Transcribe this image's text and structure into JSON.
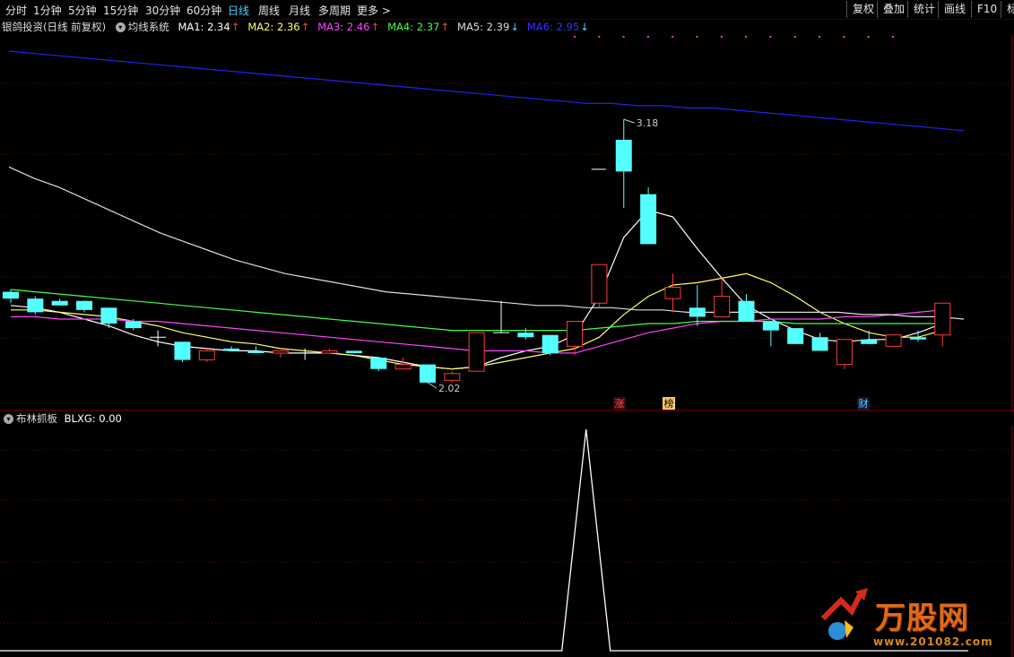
{
  "toolbar": {
    "periods": [
      "分时",
      "1分钟",
      "5分钟",
      "15分钟",
      "30分钟",
      "60分钟",
      "日线",
      "周线",
      "月线",
      "多周期",
      "更多 >"
    ],
    "active_period": "日线",
    "right_buttons": [
      "复权",
      "叠加",
      "统计",
      "画线",
      "F10",
      "标"
    ]
  },
  "info": {
    "stock": "银鸽投资(日线 前复权)",
    "indicator": "均线系统",
    "ma": [
      {
        "label": "MA1: 2.34",
        "arrow": "↑",
        "color": "#ffffff",
        "arrow_color": "#ff4444"
      },
      {
        "label": "MA2: 2.36",
        "arrow": "↑",
        "color": "#ffff66",
        "arrow_color": "#ff4444"
      },
      {
        "label": "MA3: 2.46",
        "arrow": "↑",
        "color": "#ff44ff",
        "arrow_color": "#ff4444"
      },
      {
        "label": "MA4: 2.37",
        "arrow": "↑",
        "color": "#44ff44",
        "arrow_color": "#ff4444"
      },
      {
        "label": "MA5: 2.39",
        "arrow": "↓",
        "color": "#dddddd",
        "arrow_color": "#44ddff"
      },
      {
        "label": "MA6: 2.95",
        "arrow": "↓",
        "color": "#3333ff",
        "arrow_color": "#44ddff"
      }
    ]
  },
  "price_chart": {
    "high_label": "3.18",
    "low_label": "2.02",
    "markers": [
      {
        "text": "涨",
        "color": "#ff5555",
        "bg": "#3a0a0a"
      },
      {
        "text": "榜",
        "color": "#000000",
        "bg": "#ffcc66"
      },
      {
        "text": "财",
        "color": "#66ccff",
        "bg": "#0a1a3a"
      }
    ],
    "candles": [
      {
        "o": 2.42,
        "c": 2.39,
        "h": 2.43,
        "l": 2.37
      },
      {
        "o": 2.39,
        "c": 2.33,
        "h": 2.4,
        "l": 2.32
      },
      {
        "o": 2.38,
        "c": 2.36,
        "h": 2.39,
        "l": 2.36
      },
      {
        "o": 2.38,
        "c": 2.34,
        "h": 2.38,
        "l": 2.33
      },
      {
        "o": 2.35,
        "c": 2.28,
        "h": 2.35,
        "l": 2.26
      },
      {
        "o": 2.29,
        "c": 2.26,
        "h": 2.3,
        "l": 2.25
      },
      {
        "o": 2.22,
        "c": 2.22,
        "h": 2.25,
        "l": 2.18
      },
      {
        "o": 2.2,
        "c": 2.12,
        "h": 2.2,
        "l": 2.11
      },
      {
        "o": 2.12,
        "c": 2.16,
        "h": 2.17,
        "l": 2.11
      },
      {
        "o": 2.17,
        "c": 2.16,
        "h": 2.18,
        "l": 2.16
      },
      {
        "o": 2.16,
        "c": 2.15,
        "h": 2.18,
        "l": 2.15
      },
      {
        "o": 2.15,
        "c": 2.16,
        "h": 2.16,
        "l": 2.13
      },
      {
        "o": 2.15,
        "c": 2.15,
        "h": 2.17,
        "l": 2.12
      },
      {
        "o": 2.15,
        "c": 2.16,
        "h": 2.17,
        "l": 2.15
      },
      {
        "o": 2.16,
        "c": 2.15,
        "h": 2.16,
        "l": 2.15
      },
      {
        "o": 2.13,
        "c": 2.08,
        "h": 2.13,
        "l": 2.07
      },
      {
        "o": 2.08,
        "c": 2.1,
        "h": 2.13,
        "l": 2.08
      },
      {
        "o": 2.1,
        "c": 2.02,
        "h": 2.1,
        "l": 2.02
      },
      {
        "o": 2.03,
        "c": 2.06,
        "h": 2.07,
        "l": 2.02
      },
      {
        "o": 2.07,
        "c": 2.24,
        "h": 2.24,
        "l": 2.07
      },
      {
        "o": 2.24,
        "c": 2.24,
        "h": 2.38,
        "l": 2.24
      },
      {
        "o": 2.24,
        "c": 2.22,
        "h": 2.26,
        "l": 2.21
      },
      {
        "o": 2.23,
        "c": 2.15,
        "h": 2.23,
        "l": 2.14
      },
      {
        "o": 2.18,
        "c": 2.29,
        "h": 2.29,
        "l": 2.14
      },
      {
        "o": 2.37,
        "c": 2.54,
        "h": 2.54,
        "l": 2.35
      },
      {
        "o": 3.09,
        "c": 2.95,
        "h": 3.18,
        "l": 2.79
      },
      {
        "o": 2.85,
        "c": 2.63,
        "h": 2.88,
        "l": 2.63
      },
      {
        "o": 2.39,
        "c": 2.44,
        "h": 2.5,
        "l": 2.33
      },
      {
        "o": 2.35,
        "c": 2.31,
        "h": 2.45,
        "l": 2.27
      },
      {
        "o": 2.31,
        "c": 2.4,
        "h": 2.48,
        "l": 2.31
      },
      {
        "o": 2.38,
        "c": 2.29,
        "h": 2.41,
        "l": 2.29
      },
      {
        "o": 2.29,
        "c": 2.25,
        "h": 2.29,
        "l": 2.18
      },
      {
        "o": 2.26,
        "c": 2.19,
        "h": 2.26,
        "l": 2.19
      },
      {
        "o": 2.22,
        "c": 2.16,
        "h": 2.24,
        "l": 2.16
      },
      {
        "o": 2.1,
        "c": 2.21,
        "h": 2.21,
        "l": 2.08
      },
      {
        "o": 2.21,
        "c": 2.19,
        "h": 2.25,
        "l": 2.19
      },
      {
        "o": 2.18,
        "c": 2.23,
        "h": 2.23,
        "l": 2.18
      },
      {
        "o": 2.22,
        "c": 2.21,
        "h": 2.25,
        "l": 2.2
      },
      {
        "o": 2.23,
        "c": 2.37,
        "h": 2.37,
        "l": 2.18
      }
    ],
    "ma_lines": [
      {
        "name": "MA1",
        "color": "#ffffff",
        "values": [
          2.36,
          2.35,
          2.33,
          2.3,
          2.27,
          2.23,
          2.2,
          2.18,
          2.17,
          2.16,
          2.16,
          2.15,
          2.15,
          2.15,
          2.14,
          2.13,
          2.11,
          2.09,
          2.08,
          2.09,
          2.13,
          2.16,
          2.18,
          2.23,
          2.4,
          2.66,
          2.78,
          2.75,
          2.61,
          2.48,
          2.36,
          2.3,
          2.25,
          2.21,
          2.2,
          2.21,
          2.21,
          2.24,
          2.28
        ]
      },
      {
        "name": "MA2",
        "color": "#ffff66",
        "values": [
          2.34,
          2.34,
          2.33,
          2.32,
          2.31,
          2.29,
          2.27,
          2.24,
          2.22,
          2.2,
          2.19,
          2.17,
          2.16,
          2.15,
          2.14,
          2.12,
          2.1,
          2.09,
          2.08,
          2.09,
          2.11,
          2.13,
          2.15,
          2.17,
          2.22,
          2.32,
          2.4,
          2.45,
          2.46,
          2.48,
          2.5,
          2.46,
          2.4,
          2.33,
          2.28,
          2.24,
          2.22,
          2.22,
          2.25
        ]
      },
      {
        "name": "MA3",
        "color": "#ff44ff",
        "values": [
          2.31,
          2.31,
          2.3,
          2.3,
          2.3,
          2.29,
          2.29,
          2.28,
          2.27,
          2.26,
          2.25,
          2.24,
          2.23,
          2.22,
          2.21,
          2.2,
          2.19,
          2.18,
          2.17,
          2.16,
          2.16,
          2.16,
          2.15,
          2.15,
          2.18,
          2.21,
          2.24,
          2.26,
          2.28,
          2.29,
          2.29,
          2.3,
          2.3,
          2.3,
          2.31,
          2.31,
          2.32,
          2.33,
          2.34
        ]
      },
      {
        "name": "MA4",
        "color": "#44ff44",
        "values": [
          2.43,
          2.42,
          2.41,
          2.4,
          2.39,
          2.38,
          2.37,
          2.36,
          2.35,
          2.34,
          2.33,
          2.32,
          2.31,
          2.3,
          2.29,
          2.28,
          2.27,
          2.26,
          2.25,
          2.25,
          2.25,
          2.25,
          2.25,
          2.25,
          2.26,
          2.27,
          2.28,
          2.28,
          2.29,
          2.29,
          2.29,
          2.29,
          2.28,
          2.28,
          2.28,
          2.28,
          2.28,
          2.28,
          2.28
        ]
      },
      {
        "name": "MA5",
        "color": "#dddddd",
        "values": [
          2.97,
          2.92,
          2.88,
          2.83,
          2.78,
          2.73,
          2.68,
          2.64,
          2.6,
          2.56,
          2.53,
          2.5,
          2.48,
          2.46,
          2.44,
          2.42,
          2.41,
          2.4,
          2.39,
          2.38,
          2.37,
          2.36,
          2.36,
          2.35,
          2.35,
          2.34,
          2.34,
          2.33,
          2.33,
          2.33,
          2.33,
          2.33,
          2.33,
          2.33,
          2.32,
          2.32,
          2.31,
          2.31,
          2.3
        ]
      },
      {
        "name": "MA6",
        "color": "#2222ee",
        "values": [
          3.48,
          3.47,
          3.46,
          3.45,
          3.44,
          3.43,
          3.42,
          3.41,
          3.4,
          3.39,
          3.38,
          3.37,
          3.36,
          3.35,
          3.34,
          3.33,
          3.32,
          3.31,
          3.3,
          3.29,
          3.28,
          3.27,
          3.26,
          3.25,
          3.25,
          3.24,
          3.24,
          3.23,
          3.23,
          3.22,
          3.21,
          3.2,
          3.19,
          3.18,
          3.17,
          3.16,
          3.15,
          3.14,
          3.13
        ]
      }
    ]
  },
  "indicator": {
    "name": "布林抓板",
    "value_label": "BLXG: 0.00",
    "values": [
      0,
      0,
      0,
      0,
      0,
      0,
      0,
      0,
      0,
      0,
      0,
      0,
      0,
      0,
      0,
      0,
      0,
      0,
      0,
      0,
      0,
      0,
      0,
      1,
      0,
      0,
      0,
      0,
      0,
      0,
      0,
      0,
      0,
      0,
      0,
      0,
      0,
      0,
      0
    ],
    "color": "#ffffff"
  },
  "watermark": {
    "brand": "万股网",
    "url": "www.201082.com"
  }
}
